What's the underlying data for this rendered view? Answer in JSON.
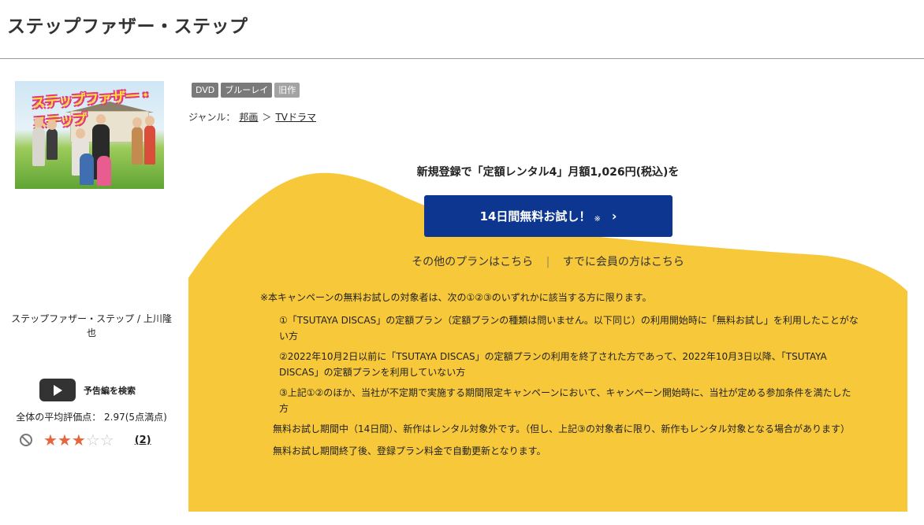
{
  "page": {
    "title": "ステップファザー・ステップ"
  },
  "tags": [
    "DVD",
    "ブルーレイ",
    "旧作"
  ],
  "genre": {
    "label": "ジャンル：",
    "category": "邦画",
    "arrow": "＞",
    "subcategory": "TVドラマ"
  },
  "promo": {
    "headline": "新規登録で「定額レンタル4」月額1,026円(税込)を",
    "cta_label": "14日間無料お試し！",
    "cta_mark": "※",
    "cta_chevron": "›",
    "other_plans": "その他のプランはこちら",
    "separator": "|",
    "members_link": "すでに会員の方はこちら"
  },
  "notes": {
    "lead": "※本キャンペーンの無料お試しの対象者は、次の①②③のいずれかに該当する方に限ります。",
    "items": [
      "①「TSUTAYA DISCAS」の定額プラン（定額プランの種類は問いません。以下同じ）の利用開始時に「無料お試し」を利用したことがない方",
      "②2022年10月2日以前に「TSUTAYA DISCAS」の定額プランの利用を終了された方であって、2022年10月3日以降、「TSUTAYA DISCAS」の定額プランを利用していない方",
      "③上記①②のほか、当社が不定期で実施する期間限定キャンペーンにおいて、キャンペーン開始時に、当社が定める参加条件を満たした方"
    ],
    "para1": "無料お試し期間中（14日間）、新作はレンタル対象外です。（但し、上記③の対象者に限り、新作もレンタル対象となる場合があります）",
    "para2": "無料お試し期間終了後、登録プラン料金で自動更新となります。"
  },
  "side": {
    "title_credit": "ステップファザー・ステップ / 上川隆也",
    "thumbnail_logo": "ステップファザー・ステップ",
    "trailer_label": "予告編を検索",
    "rating_text": "全体の平均評価点： 2.97(5点満点)",
    "rating_value": 2.97,
    "rating_max": 5,
    "stars_filled": 3,
    "review_count": "(2)"
  },
  "colors": {
    "accent_yellow": "#f7c83a",
    "cta_blue": "#0c3690",
    "star": "#e8643a"
  },
  "icons": [
    "play-icon",
    "no-entry-icon",
    "star-icon",
    "chevron-right-icon"
  ]
}
